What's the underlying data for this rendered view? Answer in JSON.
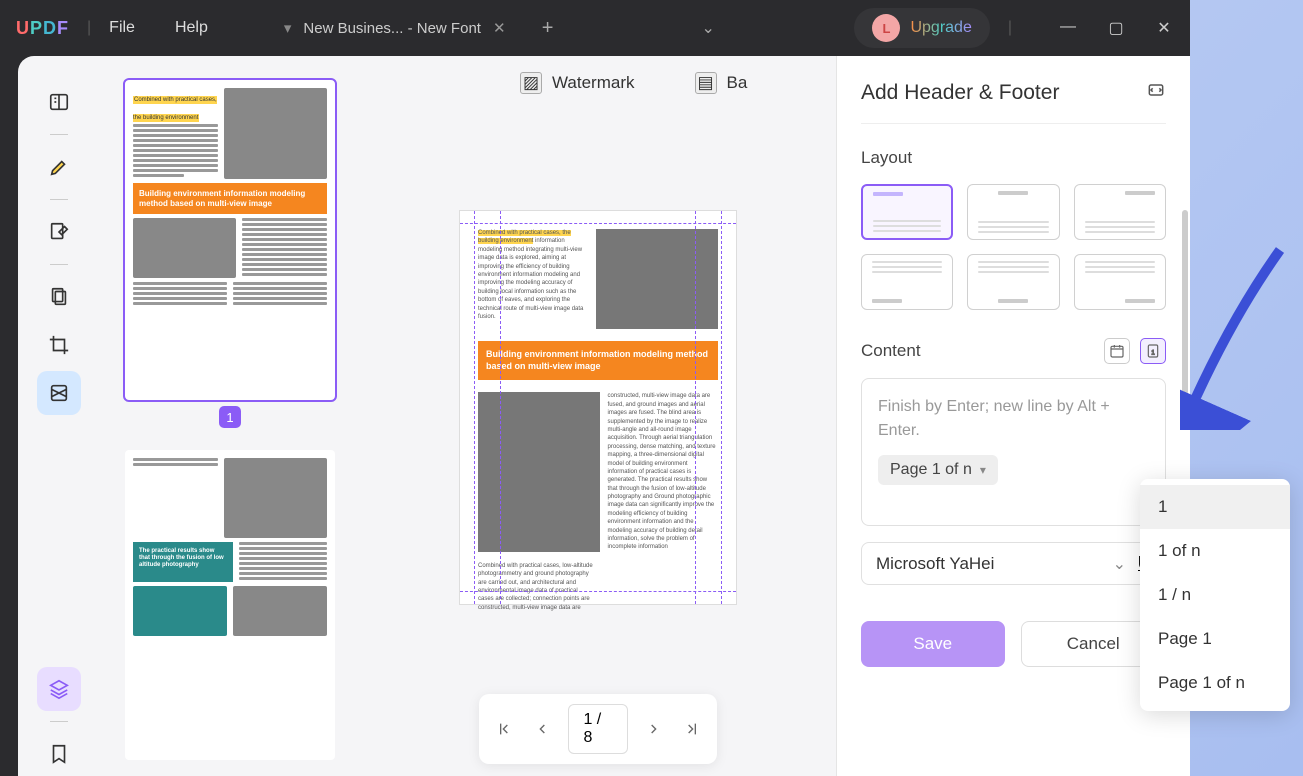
{
  "titlebar": {
    "file": "File",
    "help": "Help",
    "tab_title": "New Busines... - New Font",
    "upgrade_label": "Upgrade",
    "avatar_letter": "L"
  },
  "top_actions": {
    "watermark": "Watermark",
    "background": "Ba"
  },
  "right_panel": {
    "title": "Add Header & Footer",
    "layout_label": "Layout",
    "content_label": "Content",
    "placeholder": "Finish by Enter; new line by Alt + Enter.",
    "chip": "Page 1 of n",
    "font_name": "Microsoft YaHei",
    "save": "Save",
    "cancel": "Cancel"
  },
  "dropdown": {
    "opt1": "1",
    "opt2": "1 of n",
    "opt3": "1 / n",
    "opt4": "Page 1",
    "opt5": "Page 1 of n"
  },
  "pager": {
    "current": "1",
    "total": "8"
  },
  "thumb": {
    "page1": "1",
    "banner": "Building environment information modeling method based on multi-view image",
    "highlight": "Combined with practical cases, the building environment"
  },
  "doc": {
    "banner": "Building environment information modeling method based on multi-view image"
  }
}
